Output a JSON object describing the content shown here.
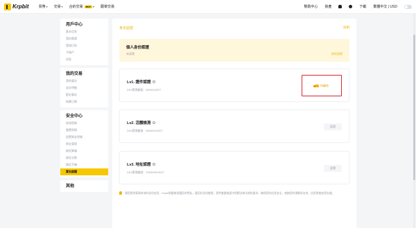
{
  "topbar": {
    "logo_text": "Krpbit",
    "nav": [
      {
        "label": "買幣"
      },
      {
        "label": "交易"
      },
      {
        "label": "合約交易",
        "badge": "HOT"
      },
      {
        "label": "跟單交易"
      }
    ],
    "right": {
      "help": "幫助中心",
      "assets": "資產",
      "download": "下載",
      "lang_currency": "繁體中文 | USD"
    }
  },
  "sidebar": {
    "groups": [
      {
        "title": "用戶中心",
        "items": [
          "基本信息",
          "我的邀請",
          "登錄日誌",
          "子帳戶",
          "消息"
        ]
      },
      {
        "title": "我的交易",
        "items": [
          "我的委託",
          "成交明細",
          "歷史委託",
          "結算日期"
        ]
      },
      {
        "title": "安全中心",
        "items": [
          "修改密碼",
          "重置密碼",
          "設置資金密碼",
          "地址管理",
          "綁定郵箱",
          "綁定谷歌",
          "綁定手機",
          "實名認證"
        ]
      },
      {
        "title": "其他",
        "items": []
      }
    ],
    "active_item": "實名認證"
  },
  "main": {
    "title": "身份認證",
    "link": "說明",
    "identity": {
      "title": "個人身份認證",
      "status": "未認證",
      "link": "前往認證"
    },
    "levels": [
      {
        "title": "Lv1. 證件認證",
        "limit": "24H提現額度：50000USDT",
        "button": "待審核"
      },
      {
        "title": "Lv2. 活體檢測",
        "limit": "24H提現額度：500000USDT",
        "button": "認證"
      },
      {
        "title": "Lv3. 地址認證",
        "limit": "24H提現額度：1000000USDT",
        "button": "認證"
      }
    ],
    "notice": "請您提供真實有效的身份信息，Krpbit將嚴格保護您的隱私，僅用於身份驗證，我們會嚴格遵守相關法律法規的要求，確保您的信息安全，感謝您的理解與支持，信息將被加密存儲。"
  },
  "colors": {
    "accent": "#f6c800",
    "highlight_border": "#d9262b",
    "link": "#e8b800"
  }
}
